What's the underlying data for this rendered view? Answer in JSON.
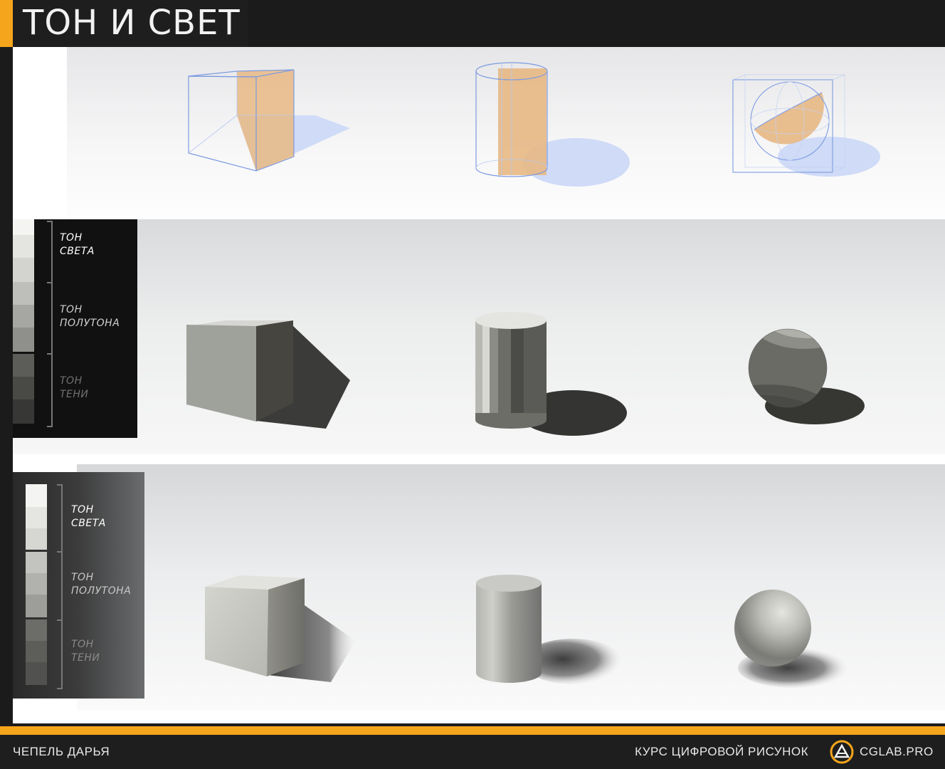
{
  "header": {
    "title": "ТОН И СВЕТ"
  },
  "legend_dark": {
    "light_label_1": "ТОН",
    "light_label_2": "СВЕТА",
    "mid_label_1": "ТОН",
    "mid_label_2": "ПОЛУТОНА",
    "shadow_label_1": "ТОН",
    "shadow_label_2": "ТЕНИ"
  },
  "legend_grey": {
    "light_label_1": "ТОН",
    "light_label_2": "СВЕТА",
    "mid_label_1": "ТОН",
    "mid_label_2": "ПОЛУТОНА",
    "shadow_label_1": "ТОН",
    "shadow_label_2": "ТЕНИ"
  },
  "footer": {
    "author": "ЧЕПЕЛЬ ДАРЬЯ",
    "course": "КУРС ЦИФРОВОЙ РИСУНОК",
    "brand": "CGLAB.PRO"
  },
  "colors": {
    "accent": "#f5a51b",
    "light_face": "#e7b884",
    "shadow_blue": "#cfdbf7"
  }
}
